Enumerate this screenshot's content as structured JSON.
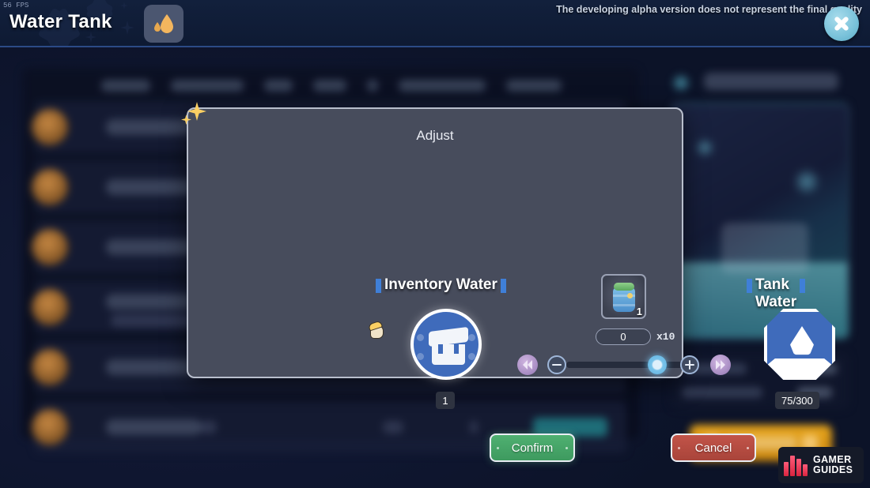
{
  "header": {
    "fps": "56 FPS",
    "title": "Water Tank",
    "drop_icon": "water-drop-icon",
    "alpha_note": "The developing alpha version does not represent the final quality",
    "close_icon": "close-icon"
  },
  "modal": {
    "title": "Adjust",
    "left": {
      "label": "Inventory Water",
      "icon": "backpack-icon",
      "count": "1"
    },
    "center": {
      "item_icon": "water-barrel-item-icon",
      "item_qty": "1",
      "amount_value": "0",
      "multiplier": "x10",
      "rewind_icon": "rewind-icon",
      "minus_icon": "minus-icon",
      "plus_icon": "plus-icon",
      "fastforward_icon": "fast-forward-icon",
      "slider_percent": 72
    },
    "right": {
      "label": "Tank Water",
      "icon": "water-tank-icon",
      "count": "75/300"
    },
    "confirm_label": "Confirm",
    "cancel_label": "Cancel"
  },
  "watermark": {
    "line1": "GAMER",
    "line2": "GUIDES"
  },
  "colors": {
    "modal_bg": "#474c5c",
    "accent_blue": "#3f6bbb",
    "label_tick": "#3f7fd8",
    "confirm_green": "#4fb071",
    "cancel_red": "#c25449",
    "slider_purple": "#a98ec4",
    "thumb_blue": "#5fb2e0",
    "close_blue": "#79c2da",
    "header_drop_orange": "#f0b35a"
  }
}
